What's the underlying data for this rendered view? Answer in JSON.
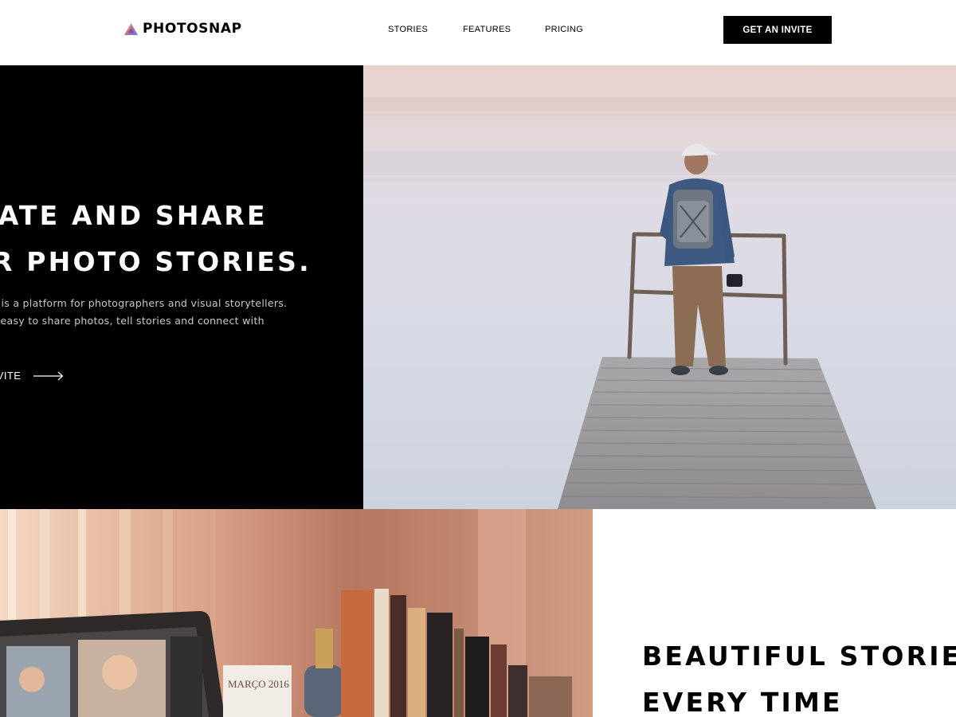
{
  "header": {
    "logo_text": "PHOTOSNAP",
    "logo_icon": "triangle-gradient-icon",
    "nav": [
      {
        "label": "STORIES"
      },
      {
        "label": "FEATURES"
      },
      {
        "label": "PRICING"
      }
    ],
    "cta_label": "GET AN INVITE"
  },
  "hero": {
    "title_lines": [
      "EATE AND SHARE",
      "UR PHOTO STORIES."
    ],
    "text_lines": [
      "ap is a platform for photographers and visual storytellers.",
      "e it easy to share photos, tell stories and connect with"
    ],
    "link_label": "NVITE",
    "link_icon": "arrow-right-icon"
  },
  "feature": {
    "title_lines": [
      "BEAUTIFUL STORIES",
      "EVERY TIME"
    ],
    "calendar_text": "MARÇO 2016"
  },
  "colors": {
    "black": "#000000",
    "white": "#ffffff",
    "logo_gradient": [
      "#ffc593",
      "#bc7198",
      "#5a77ff"
    ]
  }
}
